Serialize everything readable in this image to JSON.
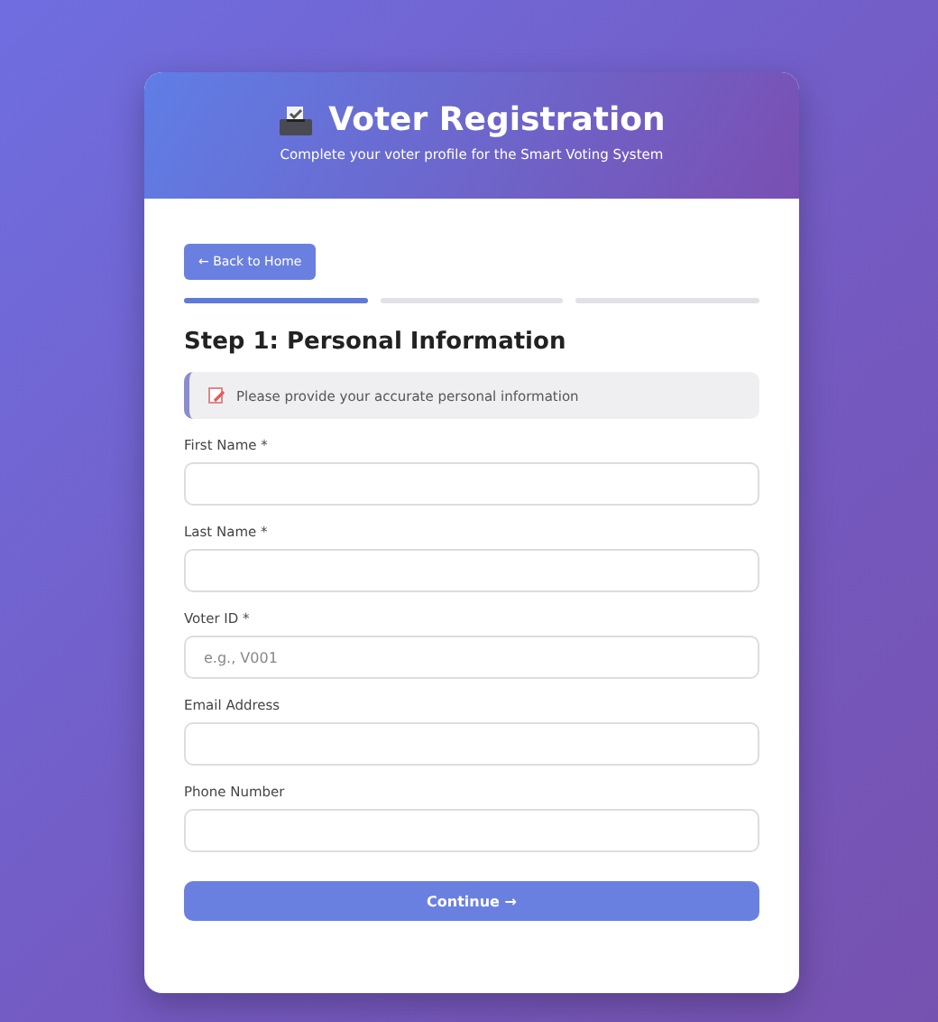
{
  "header": {
    "title": "Voter Registration",
    "subtitle": "Complete your voter profile for the Smart Voting System"
  },
  "back_button": "← Back to Home",
  "steps": [
    {
      "selected": true
    },
    {
      "selected": false
    },
    {
      "selected": false
    }
  ],
  "step_title": "Step 1: Personal Information",
  "info": "Please provide your accurate personal information",
  "fields": [
    {
      "label": "First Name *"
    },
    {
      "label": "Last Name *"
    },
    {
      "label": "Voter ID *",
      "placeholder": "e.g., V001"
    },
    {
      "label": "Email Address"
    },
    {
      "label": "Phone Number"
    }
  ],
  "submit_button": "Continue →"
}
